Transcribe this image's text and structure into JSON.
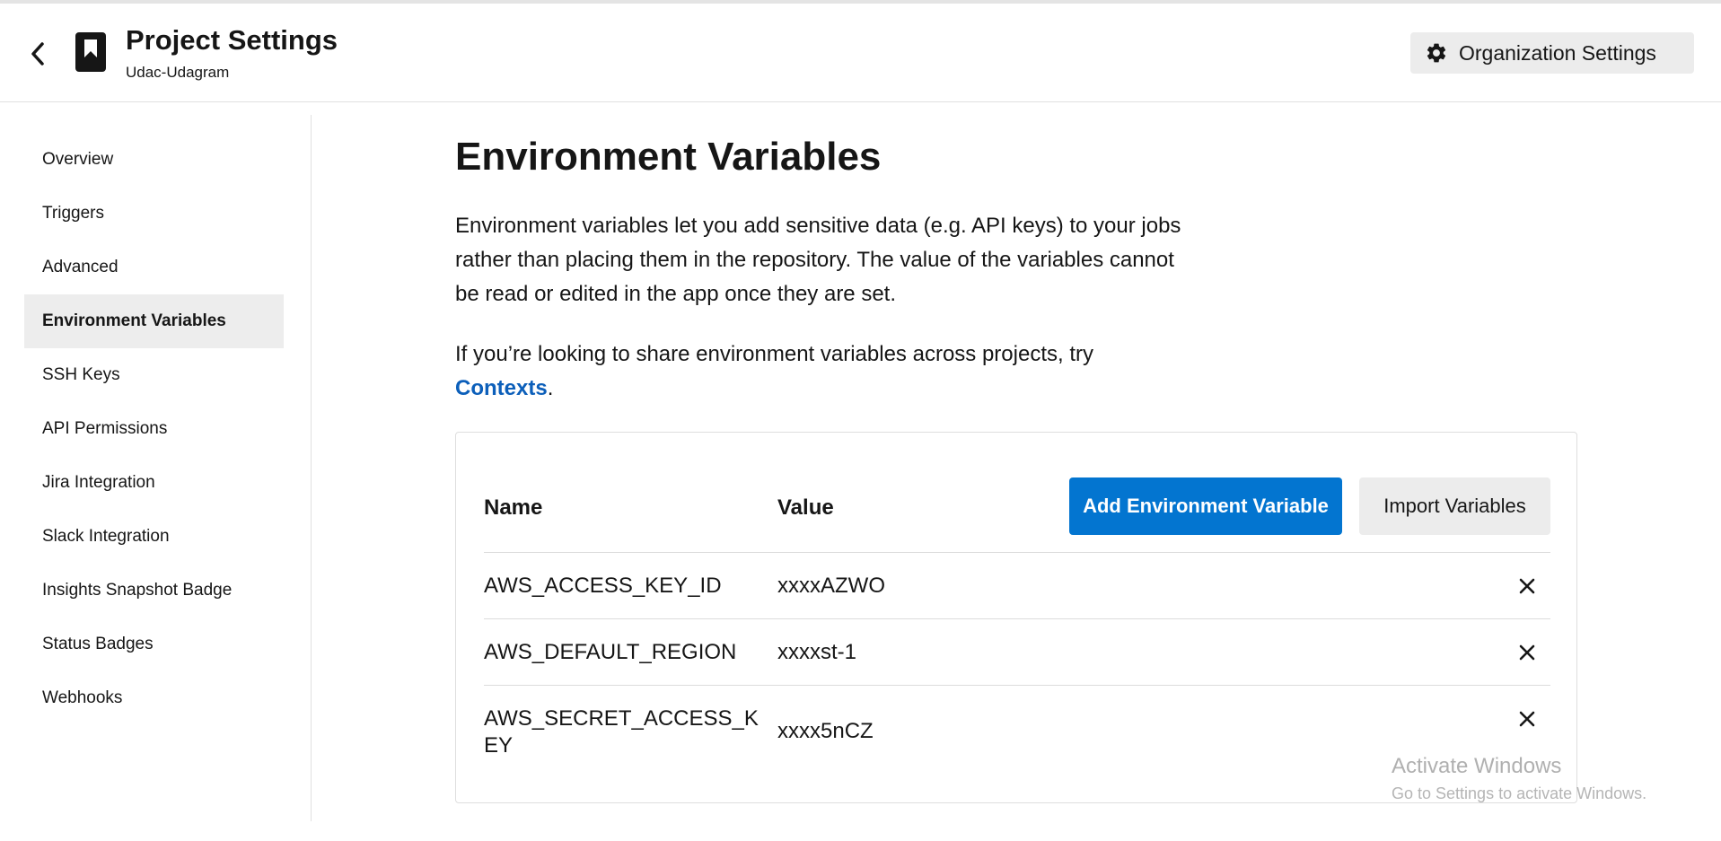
{
  "header": {
    "title": "Project Settings",
    "subtitle": "Udac-Udagram",
    "org_button_label": "Organization Settings"
  },
  "sidebar": {
    "items": [
      {
        "label": "Overview",
        "active": false
      },
      {
        "label": "Triggers",
        "active": false
      },
      {
        "label": "Advanced",
        "active": false
      },
      {
        "label": "Environment Variables",
        "active": true
      },
      {
        "label": "SSH Keys",
        "active": false
      },
      {
        "label": "API Permissions",
        "active": false
      },
      {
        "label": "Jira Integration",
        "active": false
      },
      {
        "label": "Slack Integration",
        "active": false
      },
      {
        "label": "Insights Snapshot Badge",
        "active": false
      },
      {
        "label": "Status Badges",
        "active": false
      },
      {
        "label": "Webhooks",
        "active": false
      }
    ]
  },
  "main": {
    "title": "Environment Variables",
    "description": "Environment variables let you add sensitive data (e.g. API keys) to your jobs rather than placing them in the repository. The value of the variables cannot be read or edited in the app once they are set.",
    "contexts_prefix": "If you’re looking to share environment variables across projects, try ",
    "contexts_link": "Contexts",
    "contexts_suffix": "."
  },
  "table": {
    "headers": {
      "name": "Name",
      "value": "Value"
    },
    "add_button_label": "Add Environment Variable",
    "import_button_label": "Import Variables",
    "rows": [
      {
        "name": "AWS_ACCESS_KEY_ID",
        "value": "xxxxAZWO"
      },
      {
        "name": "AWS_DEFAULT_REGION",
        "value": "xxxxst-1"
      },
      {
        "name": "AWS_SECRET_ACCESS_KEY",
        "value": "xxxx5nCZ"
      }
    ]
  },
  "watermark": {
    "title": "Activate Windows",
    "subtitle": "Go to Settings to activate Windows."
  },
  "colors": {
    "accent": "#0375d0",
    "link": "#0c5fba",
    "active_nav_bg": "#ededed",
    "button_secondary_bg": "#ececec"
  },
  "icons": {
    "back": "chevron-left-icon",
    "project": "bookmark-icon",
    "org": "gear-icon",
    "delete": "close-icon"
  }
}
